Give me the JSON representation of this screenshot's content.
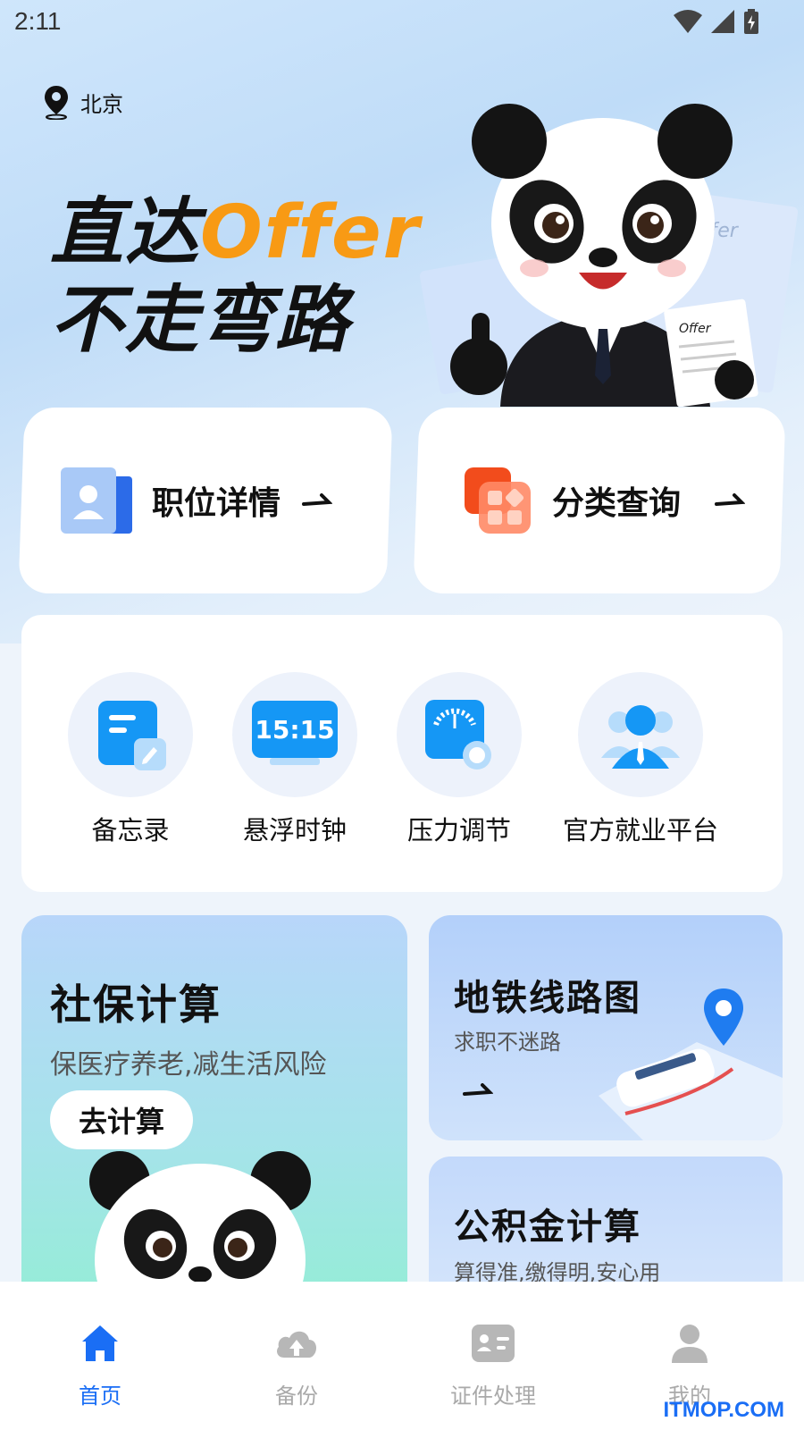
{
  "status_bar": {
    "time": "2:11"
  },
  "location": {
    "city": "北京"
  },
  "hero": {
    "slogan_line1_prefix": "直达",
    "slogan_line1_accent": "Offer",
    "slogan_line2": "不走弯路",
    "mascot_paper_text": "Offer"
  },
  "quick_cards": [
    {
      "label": "职位详情"
    },
    {
      "label": "分类查询"
    }
  ],
  "tools": [
    {
      "label": "备忘录",
      "icon": "memo-icon"
    },
    {
      "label": "悬浮时钟",
      "icon": "clock-icon",
      "clock_text": "15:15"
    },
    {
      "label": "压力调节",
      "icon": "pressure-gauge-icon"
    },
    {
      "label": "官方就业平台",
      "icon": "employee-icon"
    }
  ],
  "features": {
    "social": {
      "title": "社保计算",
      "subtitle": "保医疗养老,减生活风险",
      "button": "去计算"
    },
    "metro": {
      "title": "地铁线路图",
      "subtitle": "求职不迷路"
    },
    "fund": {
      "title": "公积金计算",
      "subtitle": "算得准,缴得明,安心用"
    }
  },
  "tab_bar": {
    "tabs": [
      {
        "label": "首页",
        "active": true
      },
      {
        "label": "备份",
        "active": false
      },
      {
        "label": "证件处理",
        "active": false
      },
      {
        "label": "我的",
        "active": false
      }
    ]
  },
  "watermark": "ITMOP.COM",
  "colors": {
    "accent": "#1a6ef5",
    "orange": "#f89a14",
    "inactive": "#a9a9a9"
  }
}
